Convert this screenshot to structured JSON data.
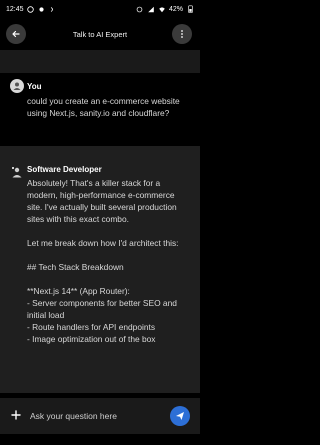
{
  "status_bar": {
    "time": "12:45",
    "battery": "42%",
    "icons": [
      "whatsapp-icon",
      "settings-icon",
      "signal-icon",
      "wifi-icon",
      "battery-icon"
    ]
  },
  "header": {
    "title": "Talk to AI Expert",
    "back_icon": "arrow-left-icon",
    "menu_icon": "more-vertical-icon"
  },
  "messages": [
    {
      "sender": "You",
      "text": "could you create an e-commerce website using Next.js, sanity.io and cloudflare?"
    },
    {
      "sender": "Software Developer",
      "text": "Absolutely! That's a killer stack for a modern, high-performance e-commerce site. I've actually built several production sites with this exact combo.\n\nLet me break down how I'd architect this:\n\n## Tech Stack Breakdown\n\n**Next.js 14** (App Router):\n- Server components for better SEO and initial load\n- Route handlers for API endpoints\n- Image optimization out of the box"
    }
  ],
  "input": {
    "placeholder": "Ask your question here"
  },
  "colors": {
    "background": "#000000",
    "assistant_bg": "#1f1f1f",
    "send_button": "#2d6fd6"
  }
}
